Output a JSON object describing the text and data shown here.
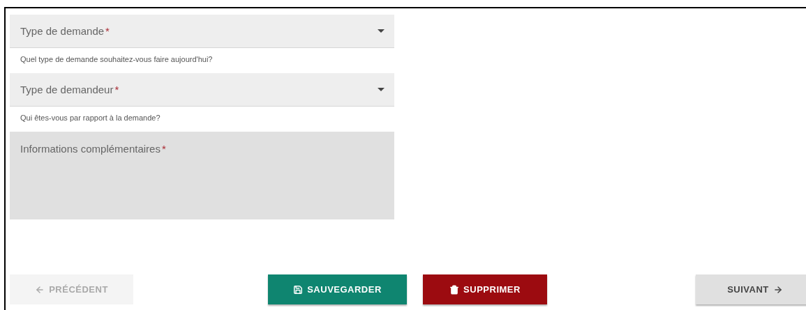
{
  "fields": [
    {
      "kind": "select",
      "label": "Type de demande",
      "required_mark": "*",
      "helper": "Quel type de demande souhaitez-vous faire aujourd'hui?"
    },
    {
      "kind": "select",
      "label": "Type de demandeur",
      "required_mark": "*",
      "helper": "Qui êtes-vous par rapport à la demande?"
    },
    {
      "kind": "textarea",
      "label": "Informations complémentaires",
      "required_mark": "*"
    }
  ],
  "buttons": [
    {
      "kind": "back",
      "label": "PRÉCÉDENT",
      "disabled": true
    },
    {
      "kind": "save",
      "label": "SAUVEGARDER",
      "disabled": false
    },
    {
      "kind": "delete",
      "label": "SUPPRIMER",
      "disabled": false
    },
    {
      "kind": "next",
      "label": "SUIVANT",
      "disabled": false
    }
  ]
}
